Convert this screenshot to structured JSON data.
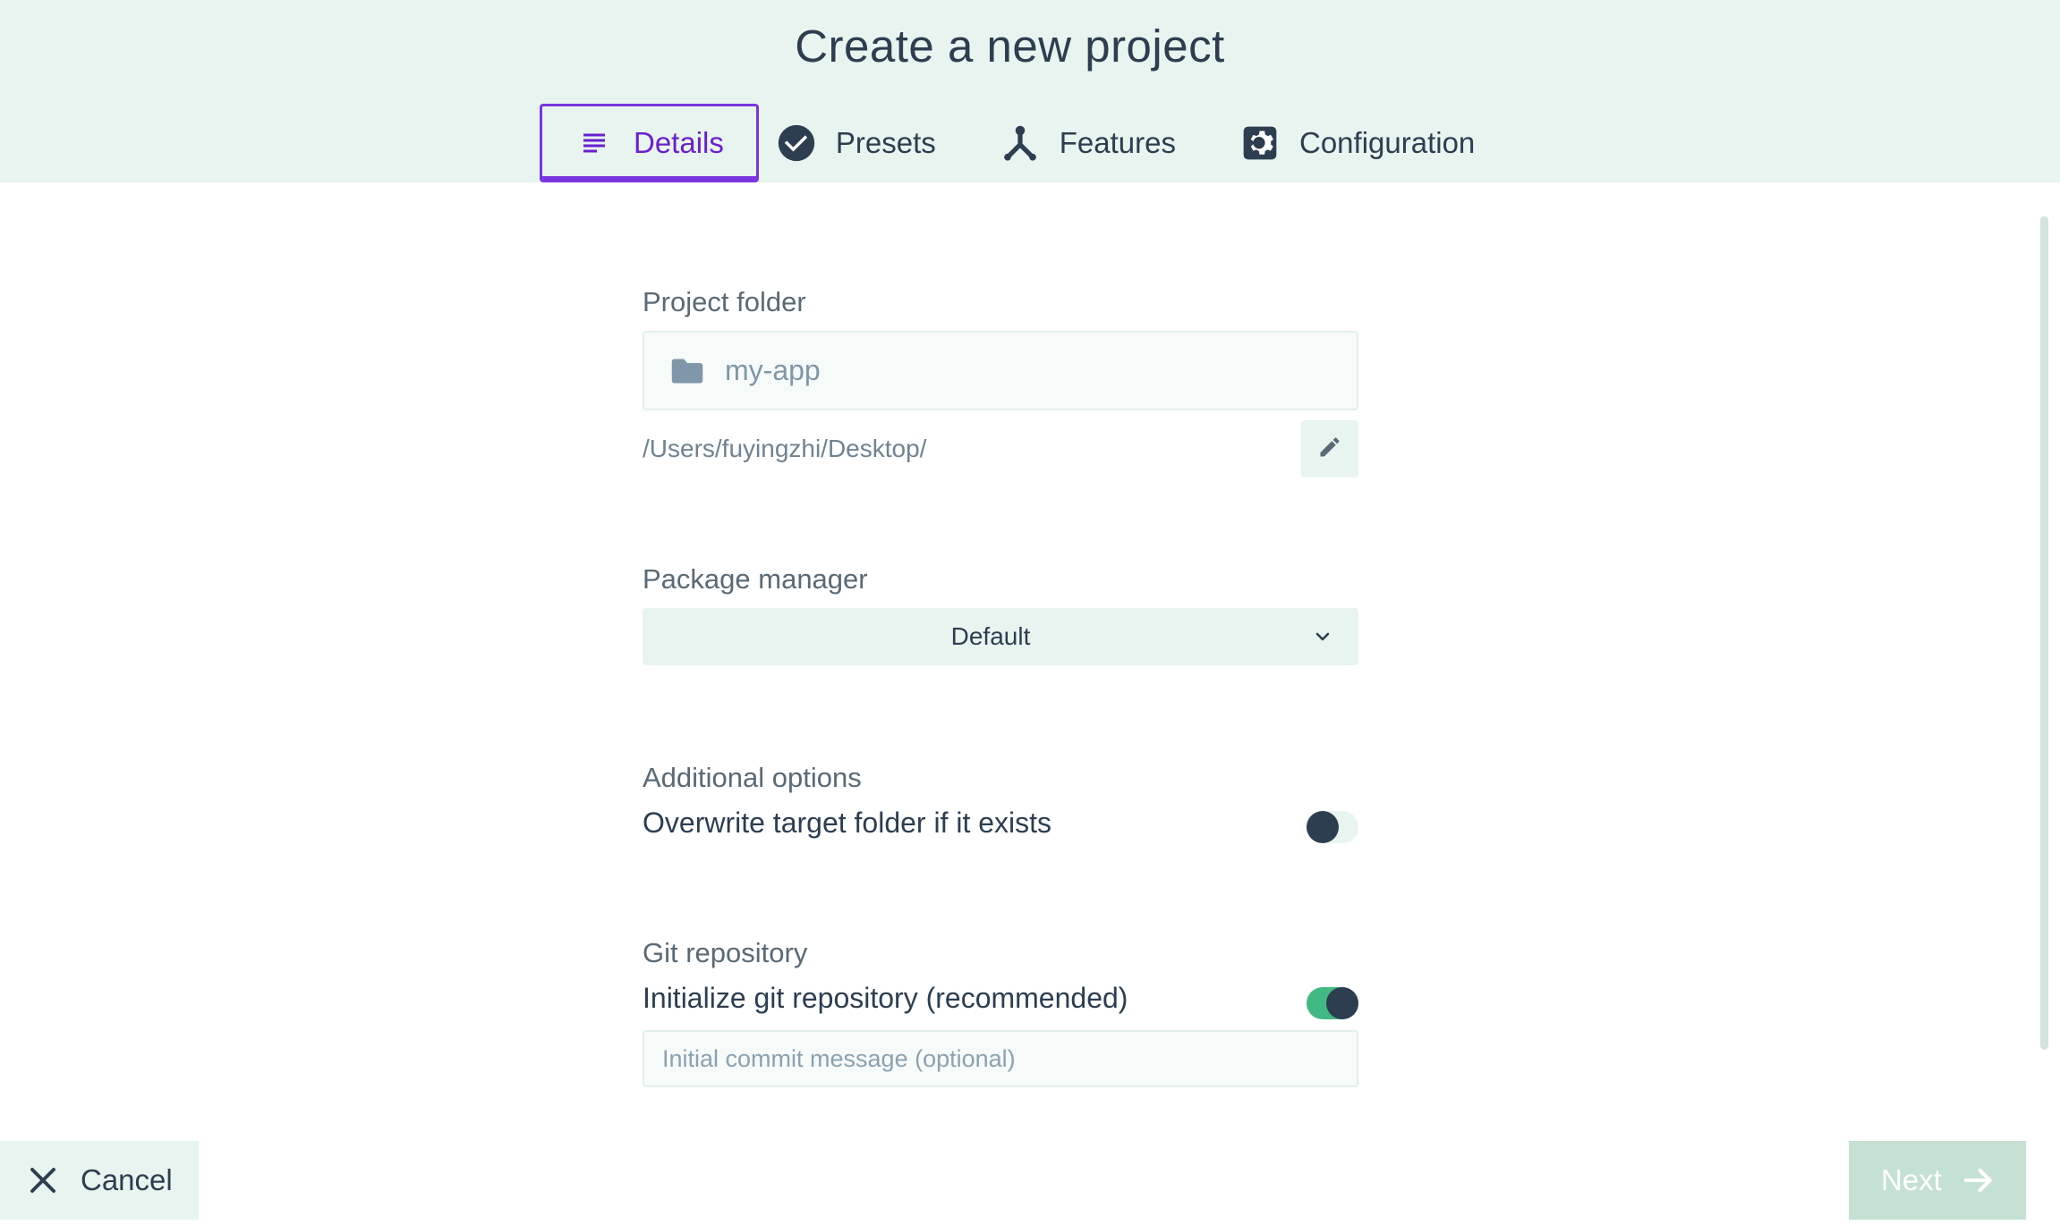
{
  "page": {
    "title": "Create a new project"
  },
  "tabs": [
    {
      "label": "Details",
      "icon": "subject-icon",
      "active": true
    },
    {
      "label": "Presets",
      "icon": "check-circle-icon",
      "active": false
    },
    {
      "label": "Features",
      "icon": "call-split-icon",
      "active": false
    },
    {
      "label": "Configuration",
      "icon": "settings-icon",
      "active": false
    }
  ],
  "project_folder": {
    "label": "Project folder",
    "value": "my-app",
    "icon": "folder-icon",
    "path": "/Users/fuyingzhi/Desktop/",
    "edit_icon": "pencil-icon"
  },
  "package_manager": {
    "label": "Package manager",
    "selected": "Default",
    "icon": "chevron-down-icon"
  },
  "additional_options": {
    "label": "Additional options",
    "overwrite_label": "Overwrite target folder if it exists",
    "overwrite_enabled": false
  },
  "git": {
    "label": "Git repository",
    "init_label": "Initialize git repository (recommended)",
    "init_enabled": true,
    "commit_placeholder": "Initial commit message (optional)",
    "commit_value": ""
  },
  "footer": {
    "cancel_label": "Cancel",
    "cancel_icon": "close-icon",
    "next_label": "Next",
    "next_icon": "arrow-right-icon",
    "next_enabled": false
  },
  "colors": {
    "header_bg": "#e8f4f0",
    "accent_purple": "#6a1fcf",
    "toggle_on": "#42b983",
    "text_dark": "#2c3e50",
    "next_disabled_bg": "#c4e1d3"
  }
}
